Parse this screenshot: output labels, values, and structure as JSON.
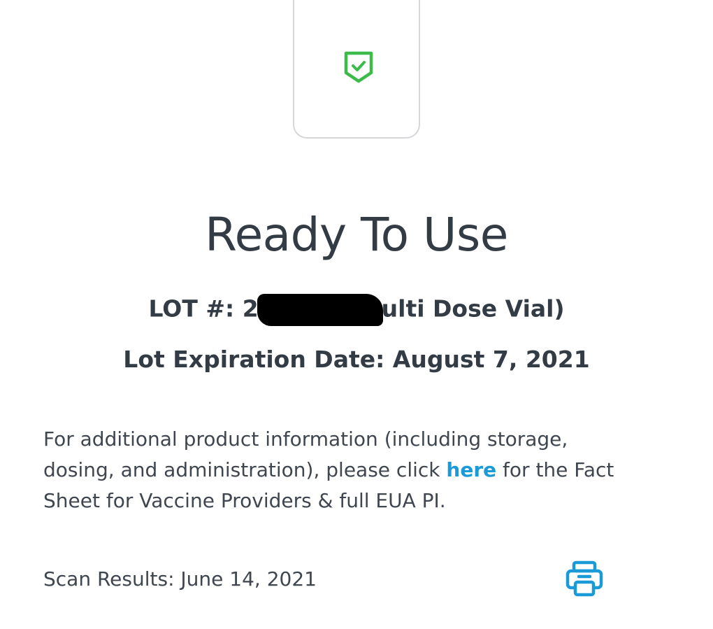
{
  "status": {
    "icon": "shield-check-icon",
    "icon_color": "#3dbb4a",
    "title": "Ready To Use"
  },
  "lot": {
    "prefix": "LOT #: 2",
    "suffix": "ulti Dose Vial)"
  },
  "expiration": {
    "text": "Lot Expiration Date: August 7, 2021"
  },
  "info": {
    "before_link": "For additional product information (including storage, dosing, and administration), please click ",
    "link_label": "here",
    "after_link": " for the Fact Sheet for Vaccine Providers & full EUA PI.",
    "link_color": "#1a9ad6"
  },
  "scan": {
    "text": "Scan Results: June 14, 2021"
  },
  "print": {
    "icon": "printer-icon",
    "color": "#1a9ad6"
  }
}
